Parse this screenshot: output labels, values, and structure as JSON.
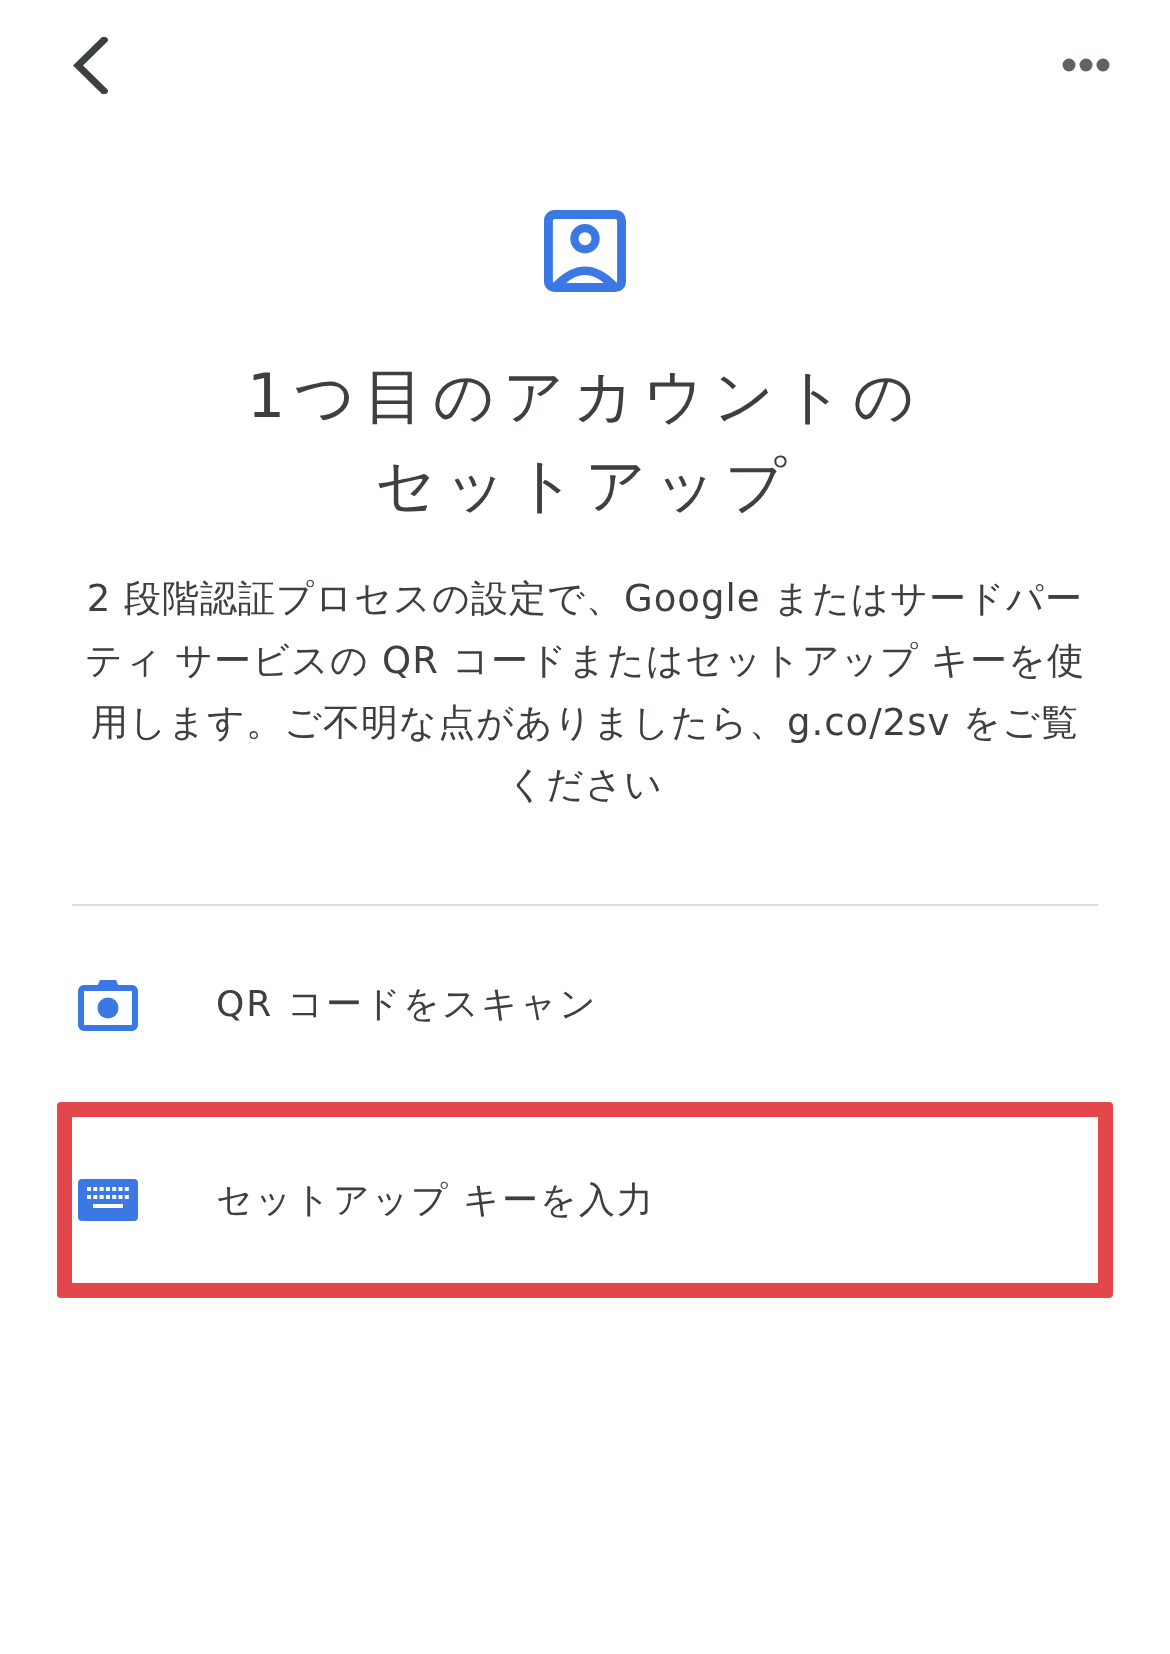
{
  "title": "1つ目のアカウントのセットアップ",
  "description": "2 段階認証プロセスの設定で、Google またはサードパーティ サービスの QR コードまたはセットアップ キーを使用します。ご不明な点がありましたら、g.co/2sv をご覧ください",
  "options": [
    {
      "kind": "camera",
      "label": "QR コードをスキャン",
      "highlighted": false
    },
    {
      "kind": "keyboard",
      "label": "セットアップ キーを入力",
      "highlighted": true
    }
  ]
}
